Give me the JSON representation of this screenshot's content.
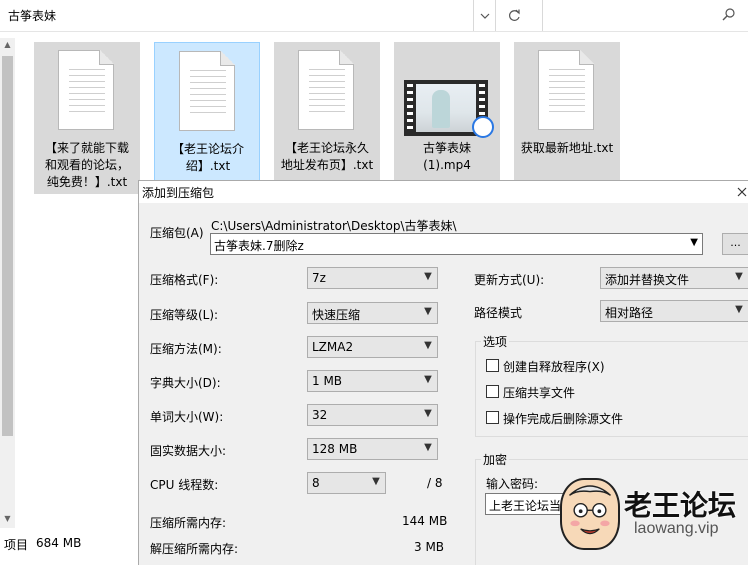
{
  "explorer": {
    "address": "古筝表妹",
    "search_placeholder": "",
    "files": [
      {
        "label": "【来了就能下载和观看的论坛，纯免费！】.txt",
        "lines": [
          "【来了就能下载",
          "和观看的论坛，",
          "纯免费！】.txt"
        ],
        "type": "txt",
        "selected": false
      },
      {
        "label": "【老王论坛介绍】.txt",
        "lines": [
          "【老王论坛介",
          "绍】.txt"
        ],
        "type": "txt",
        "selected": true
      },
      {
        "label": "【老王论坛永久地址发布页】.txt",
        "lines": [
          "【老王论坛永久",
          "地址发布页】.txt"
        ],
        "type": "txt",
        "selected": false
      },
      {
        "label": "古筝表妹 (1).mp4",
        "lines": [
          "古筝表妹",
          "(1).mp4"
        ],
        "type": "mp4",
        "selected": false
      },
      {
        "label": "获取最新地址.txt",
        "lines": [
          "获取最新地址.txt"
        ],
        "type": "txt",
        "selected": false
      }
    ],
    "status_items": "项目",
    "status_size": "684 MB"
  },
  "dialog": {
    "title": "添加到压缩包",
    "archive_label": "压缩包(A)",
    "archive_path": "C:\\Users\\Administrator\\Desktop\\古筝表妹\\",
    "archive_name": "古筝表妹.7删除z",
    "browse_label": "...",
    "format_label": "压缩格式(F):",
    "format_value": "7z",
    "level_label": "压缩等级(L):",
    "level_value": "快速压缩",
    "method_label": "压缩方法(M):",
    "method_value": "LZMA2",
    "dict_label": "字典大小(D):",
    "dict_value": "1 MB",
    "word_label": "单词大小(W):",
    "word_value": "32",
    "solid_label": "固实数据大小:",
    "solid_value": "128 MB",
    "threads_label": "CPU 线程数:",
    "threads_value": "8",
    "threads_total": "/ 8",
    "mem_comp_label": "压缩所需内存:",
    "mem_comp_value": "144 MB",
    "mem_decomp_label": "解压缩所需内存:",
    "mem_decomp_value": "3 MB",
    "update_label": "更新方式(U):",
    "update_value": "添加并替换文件",
    "path_label": "路径模式",
    "path_value": "相对路径",
    "options_title": "选项",
    "opt_sfx": "创建自释放程序(X)",
    "opt_shared": "压缩共享文件",
    "opt_delete": "操作完成后删除源文件",
    "encrypt_title": "加密",
    "password_label": "输入密码:",
    "password_value": "上老王论坛当"
  },
  "watermark": {
    "cn": "老王论坛",
    "en": "laowang.vip"
  }
}
